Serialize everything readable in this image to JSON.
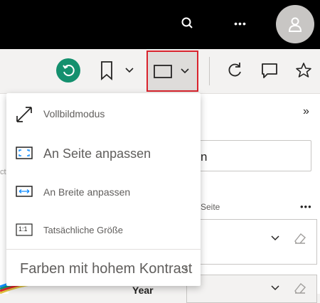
{
  "topbar": {
    "icons": [
      "search-icon",
      "more-icon",
      "avatar-icon"
    ],
    "more_glyph": "•••"
  },
  "toolbar": {
    "icons": [
      "reset-icon",
      "bookmark-icon",
      "chevron-down-icon",
      "fit-view-icon",
      "refresh-icon",
      "comment-icon",
      "star-icon"
    ]
  },
  "view_menu": {
    "items": [
      {
        "label": "Vollbildmodus",
        "icon": "fullscreen-icon"
      },
      {
        "label": "An Seite anpassen",
        "icon": "fit-to-page-icon"
      },
      {
        "label": "An Breite anpassen",
        "icon": "fit-to-width-icon"
      },
      {
        "label": "Tatsächliche Größe",
        "icon": "actual-size-icon",
        "icon_text": "1:1"
      },
      {
        "label": "Farben mit hohem Kontrast",
        "icon": "chevron-right-icon"
      }
    ]
  },
  "filters_pane": {
    "expand_glyph": "»",
    "search_value": "n",
    "section_label": "Seite",
    "more_glyph": "•••",
    "card2_value": "Year"
  },
  "canvas": {
    "hint": "ct"
  },
  "colors": {
    "accent_green": "#14906e",
    "highlight_red": "#d9232d",
    "topbar_bg": "#000000"
  }
}
